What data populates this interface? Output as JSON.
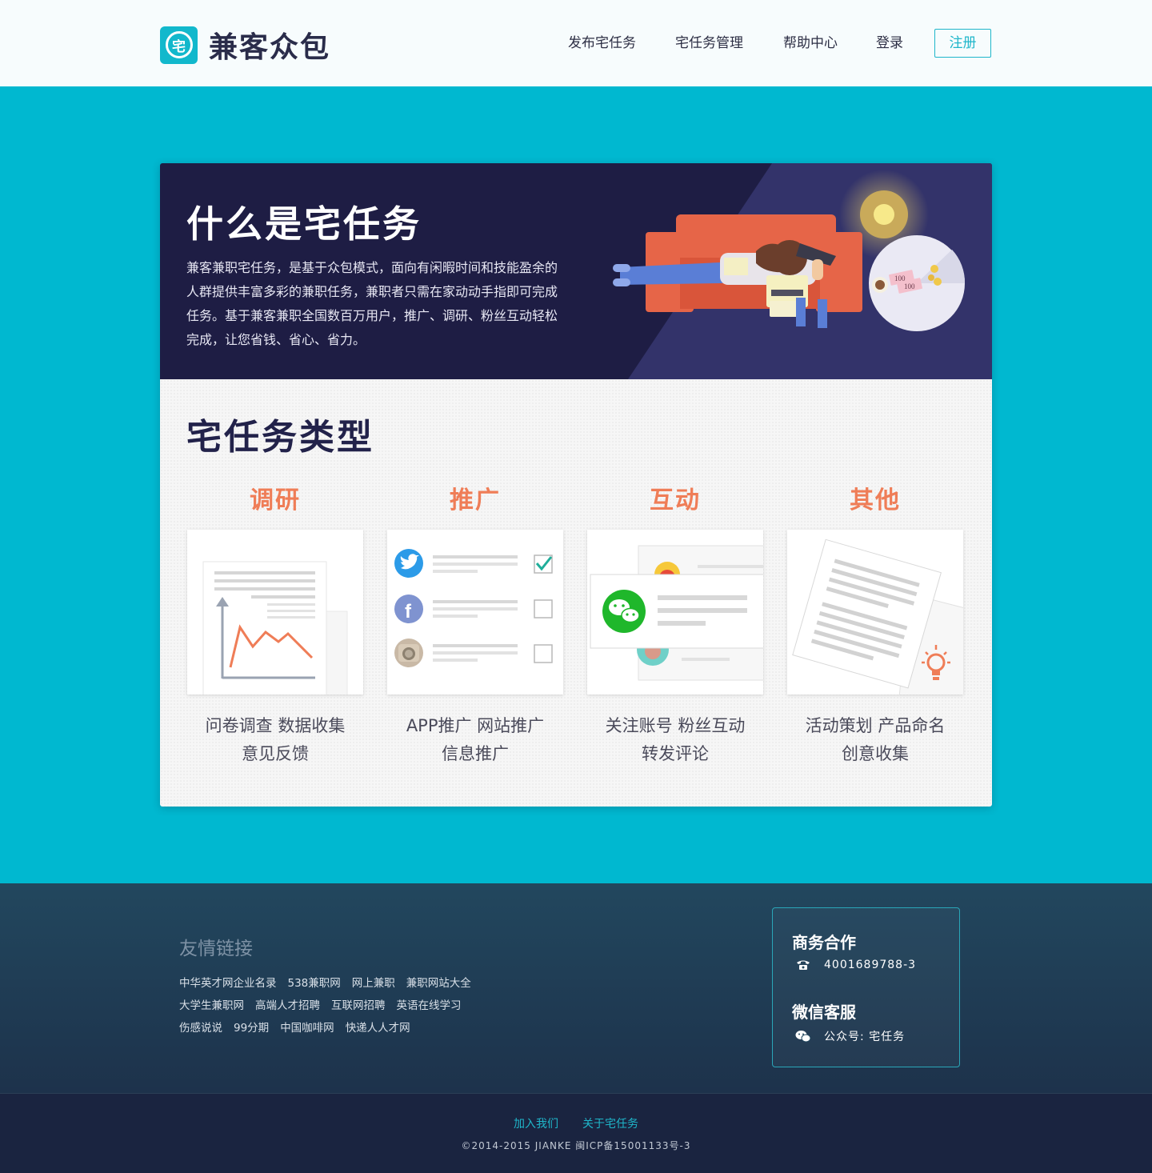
{
  "header": {
    "logo_char": "宅",
    "logo_text": "兼客众包",
    "nav": {
      "publish": "发布宅任务",
      "manage": "宅任务管理",
      "help": "帮助中心",
      "login": "登录",
      "register": "注册"
    }
  },
  "banner": {
    "title": "什么是宅任务",
    "description": "兼客兼职宅任务，是基于众包模式，面向有闲暇时间和技能盈余的人群提供丰富多彩的兼职任务，兼职者只需在家动动手指即可完成任务。基于兼客兼职全国数百万用户，推广、调研、粉丝互动轻松完成，让您省钱、省心、省力。",
    "money_label_1": "100",
    "money_label_2": "100"
  },
  "types": {
    "title": "宅任务类型",
    "items": [
      {
        "name": "调研",
        "line1": "问卷调查  数据收集",
        "line2": "意见反馈"
      },
      {
        "name": "推广",
        "line1": "APP推广  网站推广",
        "line2": "信息推广"
      },
      {
        "name": "互动",
        "line1": "关注账号  粉丝互动",
        "line2": "转发评论"
      },
      {
        "name": "其他",
        "line1": "活动策划  产品命名",
        "line2": "创意收集"
      }
    ]
  },
  "footer": {
    "links_title": "友情链接",
    "links": [
      [
        "中华英才网企业名录",
        "538兼职网",
        "网上兼职",
        "兼职网站大全"
      ],
      [
        "大学生兼职网",
        "高端人才招聘",
        "互联网招聘",
        "英语在线学习"
      ],
      [
        "伤感说说",
        "99分期",
        "中国咖啡网",
        "快递人人才网"
      ]
    ],
    "contact": {
      "business_title": "商务合作",
      "phone": "4001689788-3",
      "wechat_title": "微信客服",
      "wechat": "公众号: 宅任务"
    },
    "bottom_links": {
      "join": "加入我们",
      "about": "关于宅任务"
    },
    "copyright": "©2014-2015 JIANKE 闽ICP备15001133号-3"
  },
  "colors": {
    "primary": "#00b8d0",
    "accent": "#ef7d57",
    "banner_bg": "#1e1d44",
    "title_dark": "#22224a"
  }
}
